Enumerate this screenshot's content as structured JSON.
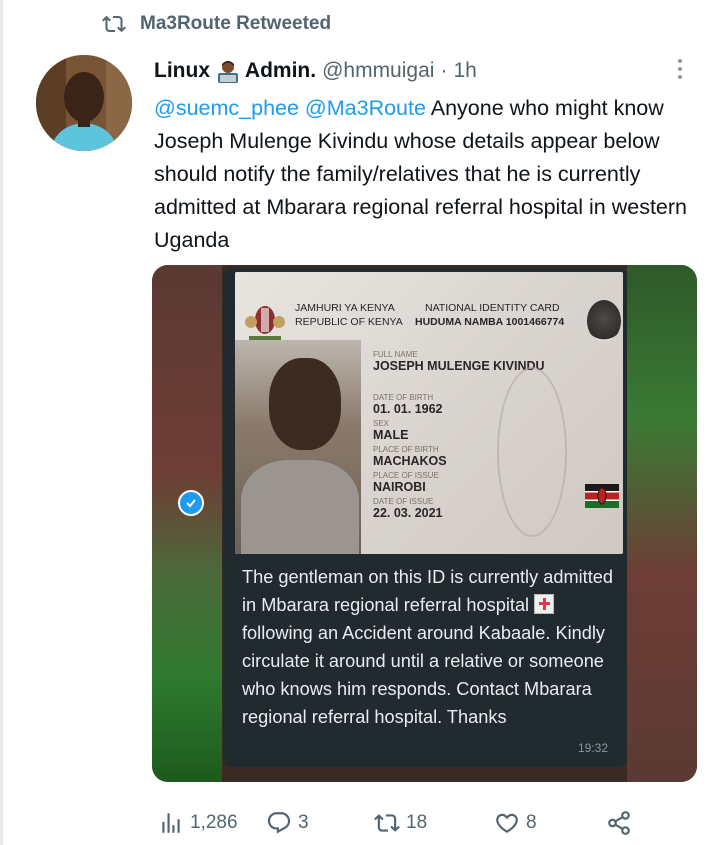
{
  "retweet": {
    "label": "Ma3Route Retweeted",
    "icon": "retweet-icon"
  },
  "author": {
    "name": "Linux",
    "name_emoji": "technologist-emoji",
    "name_suffix": "Admin.",
    "handle": "@hmmuigai",
    "separator": "·",
    "time": "1h"
  },
  "tweet": {
    "mention1": "@suemc_phee",
    "mention2": "@Ma3Route",
    "body": " Anyone who might know Joseph Mulenge Kivindu whose details appear below should notify the family/relatives that he is currently admitted at Mbarara regional referral hospital in western Uganda"
  },
  "id_card": {
    "country_sw": "JAMHURI YA KENYA",
    "country_en": "REPUBLIC OF KENYA",
    "card_title": "NATIONAL IDENTITY CARD",
    "huduma": "HUDUMA NAMBA 1001466774",
    "fullname_label": "FULL NAME",
    "fullname": "JOSEPH MULENGE KIVINDU",
    "dob_label": "DATE OF BIRTH",
    "dob": "01. 01. 1962",
    "sex_label": "SEX",
    "sex": "MALE",
    "pob_label": "PLACE OF BIRTH",
    "pob": "MACHAKOS",
    "poi_label": "PLACE OF ISSUE",
    "poi": "NAIROBI",
    "doi_label": "DATE OF ISSUE",
    "doi": "22. 03. 2021"
  },
  "chat": {
    "text_part1": "The gentleman on this ID is currently admitted in Mbarara regional referral hospital ",
    "emoji": "hospital-emoji",
    "text_part2": " following an Accident around Kabaale. Kindly circulate it around until a relative or someone who knows him responds. Contact Mbarara regional referral hospital.  Thanks",
    "time": "19:32"
  },
  "actions": {
    "views": "1,286",
    "replies": "3",
    "retweets": "18",
    "likes": "8"
  },
  "colors": {
    "accent": "#1d9bf0",
    "muted": "#536471",
    "text": "#0f1419",
    "chat_bg": "#212a2e"
  }
}
